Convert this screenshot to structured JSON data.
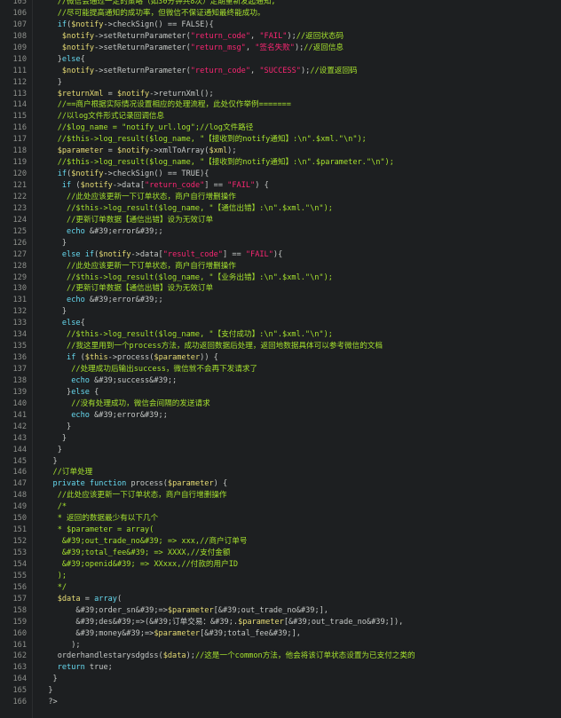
{
  "editor": {
    "lines": [
      {
        "n": "105",
        "segs": [
          {
            "t": "    "
          },
          {
            "c": "c",
            "t": "//微信会通过一定的策略（如30分钟共8次）定期重新发起通知,"
          }
        ]
      },
      {
        "n": "106",
        "segs": [
          {
            "t": "    "
          },
          {
            "c": "c",
            "t": "//尽可能提高通知的成功率，但微信不保证通知最终能成功。"
          }
        ]
      },
      {
        "n": "107",
        "segs": [
          {
            "t": "    "
          },
          {
            "c": "kw",
            "t": "if"
          },
          {
            "t": "("
          },
          {
            "c": "v",
            "t": "$notify"
          },
          {
            "t": "->checkSign() == FALSE){"
          }
        ]
      },
      {
        "n": "108",
        "segs": [
          {
            "t": "     "
          },
          {
            "c": "v",
            "t": "$notify"
          },
          {
            "t": "->setReturnParameter("
          },
          {
            "c": "s",
            "t": "\"return_code\""
          },
          {
            "t": ", "
          },
          {
            "c": "s",
            "t": "\"FAIL\""
          },
          {
            "t": ");"
          },
          {
            "c": "c",
            "t": "//返回状态码"
          }
        ]
      },
      {
        "n": "109",
        "segs": [
          {
            "t": "     "
          },
          {
            "c": "v",
            "t": "$notify"
          },
          {
            "t": "->setReturnParameter("
          },
          {
            "c": "s",
            "t": "\"return_msg\""
          },
          {
            "t": ", "
          },
          {
            "c": "s",
            "t": "\"签名失败\""
          },
          {
            "t": ");"
          },
          {
            "c": "c",
            "t": "//返回信息"
          }
        ]
      },
      {
        "n": "110",
        "segs": [
          {
            "t": "    }"
          },
          {
            "c": "kw",
            "t": "else"
          },
          {
            "t": "{"
          }
        ]
      },
      {
        "n": "111",
        "segs": [
          {
            "t": "     "
          },
          {
            "c": "v",
            "t": "$notify"
          },
          {
            "t": "->setReturnParameter("
          },
          {
            "c": "s",
            "t": "\"return_code\""
          },
          {
            "t": ", "
          },
          {
            "c": "s",
            "t": "\"SUCCESS\""
          },
          {
            "t": ");"
          },
          {
            "c": "c",
            "t": "//设置返回码"
          }
        ]
      },
      {
        "n": "112",
        "segs": [
          {
            "t": "    }"
          }
        ]
      },
      {
        "n": "113",
        "segs": [
          {
            "t": "    "
          },
          {
            "c": "v",
            "t": "$returnXml"
          },
          {
            "t": " = "
          },
          {
            "c": "v",
            "t": "$notify"
          },
          {
            "t": "->returnXml();"
          }
        ]
      },
      {
        "n": "114",
        "segs": [
          {
            "t": "    "
          },
          {
            "c": "c",
            "t": "//==商户根据实际情况设置相应的处理流程，此处仅作举例======="
          }
        ]
      },
      {
        "n": "115",
        "segs": [
          {
            "t": "    "
          },
          {
            "c": "c",
            "t": "//以log文件形式记录回调信息"
          }
        ]
      },
      {
        "n": "116",
        "segs": [
          {
            "t": "    "
          },
          {
            "c": "c",
            "t": "//$log_name = \"notify_url.log\";//log文件路径"
          }
        ]
      },
      {
        "n": "117",
        "segs": [
          {
            "t": "    "
          },
          {
            "c": "c",
            "t": "//$this->log_result($log_name, \"【接收到的notify通知】:\\n\".$xml.\"\\n\");"
          }
        ]
      },
      {
        "n": "118",
        "segs": [
          {
            "t": "    "
          },
          {
            "c": "v",
            "t": "$parameter"
          },
          {
            "t": " = "
          },
          {
            "c": "v",
            "t": "$notify"
          },
          {
            "t": "->xmlToArray("
          },
          {
            "c": "v",
            "t": "$xml"
          },
          {
            "t": ");"
          }
        ]
      },
      {
        "n": "119",
        "segs": [
          {
            "t": "    "
          },
          {
            "c": "c",
            "t": "//$this->log_result($log_name, \"【接收到的notify通知】:\\n\".$parameter.\"\\n\");"
          }
        ]
      },
      {
        "n": "120",
        "segs": [
          {
            "t": "    "
          },
          {
            "c": "kw",
            "t": "if"
          },
          {
            "t": "("
          },
          {
            "c": "v",
            "t": "$notify"
          },
          {
            "t": "->checkSign() == TRUE){"
          }
        ]
      },
      {
        "n": "121",
        "segs": [
          {
            "t": "     "
          },
          {
            "c": "kw",
            "t": "if"
          },
          {
            "t": " ("
          },
          {
            "c": "v",
            "t": "$notify"
          },
          {
            "t": "->data["
          },
          {
            "c": "s",
            "t": "\"return_code\""
          },
          {
            "t": "] == "
          },
          {
            "c": "s",
            "t": "\"FAIL\""
          },
          {
            "t": ") {"
          }
        ]
      },
      {
        "n": "122",
        "segs": [
          {
            "t": "      "
          },
          {
            "c": "c",
            "t": "//此处应该更新一下订单状态，商户自行增删操作"
          }
        ]
      },
      {
        "n": "123",
        "segs": [
          {
            "t": "      "
          },
          {
            "c": "c",
            "t": "//$this->log_result($log_name, \"【通信出错】:\\n\".$xml.\"\\n\");"
          }
        ]
      },
      {
        "n": "124",
        "segs": [
          {
            "t": "      "
          },
          {
            "c": "c",
            "t": "//更新订单数据【通信出错】设为无效订单"
          }
        ]
      },
      {
        "n": "125",
        "segs": [
          {
            "t": "      "
          },
          {
            "c": "kw",
            "t": "echo"
          },
          {
            "t": " &#39;error&#39;;"
          }
        ]
      },
      {
        "n": "126",
        "segs": [
          {
            "t": "     }"
          }
        ]
      },
      {
        "n": "127",
        "segs": [
          {
            "t": "     "
          },
          {
            "c": "kw",
            "t": "else if"
          },
          {
            "t": "("
          },
          {
            "c": "v",
            "t": "$notify"
          },
          {
            "t": "->data["
          },
          {
            "c": "s",
            "t": "\"result_code\""
          },
          {
            "t": "] == "
          },
          {
            "c": "s",
            "t": "\"FAIL\""
          },
          {
            "t": "){"
          }
        ]
      },
      {
        "n": "128",
        "segs": [
          {
            "t": "      "
          },
          {
            "c": "c",
            "t": "//此处应该更新一下订单状态，商户自行增删操作"
          }
        ]
      },
      {
        "n": "129",
        "segs": [
          {
            "t": "      "
          },
          {
            "c": "c",
            "t": "//$this->log_result($log_name, \"【业务出错】:\\n\".$xml.\"\\n\");"
          }
        ]
      },
      {
        "n": "130",
        "segs": [
          {
            "t": "      "
          },
          {
            "c": "c",
            "t": "//更新订单数据【通信出错】设为无效订单"
          }
        ]
      },
      {
        "n": "131",
        "segs": [
          {
            "t": "      "
          },
          {
            "c": "kw",
            "t": "echo"
          },
          {
            "t": " &#39;error&#39;;"
          }
        ]
      },
      {
        "n": "132",
        "segs": [
          {
            "t": "     }"
          }
        ]
      },
      {
        "n": "133",
        "segs": [
          {
            "t": "     "
          },
          {
            "c": "kw",
            "t": "else"
          },
          {
            "t": "{"
          }
        ]
      },
      {
        "n": "134",
        "segs": [
          {
            "t": "      "
          },
          {
            "c": "c",
            "t": "//$this->log_result($log_name, \"【支付成功】:\\n\".$xml.\"\\n\");"
          }
        ]
      },
      {
        "n": "135",
        "segs": [
          {
            "t": "      "
          },
          {
            "c": "c",
            "t": "//我这里用到一个process方法，成功返回数据后处理，返回地数据具体可以参考微信的文档"
          }
        ]
      },
      {
        "n": "136",
        "segs": [
          {
            "t": "      "
          },
          {
            "c": "kw",
            "t": "if"
          },
          {
            "t": " ("
          },
          {
            "c": "v",
            "t": "$this"
          },
          {
            "t": "->process("
          },
          {
            "c": "v",
            "t": "$parameter"
          },
          {
            "t": ")) {"
          }
        ]
      },
      {
        "n": "137",
        "segs": [
          {
            "t": "       "
          },
          {
            "c": "c",
            "t": "//处理成功后输出success，微信就不会再下发请求了"
          }
        ]
      },
      {
        "n": "138",
        "segs": [
          {
            "t": "       "
          },
          {
            "c": "kw",
            "t": "echo"
          },
          {
            "t": " &#39;success&#39;;"
          }
        ]
      },
      {
        "n": "139",
        "segs": [
          {
            "t": "      }"
          },
          {
            "c": "kw",
            "t": "else"
          },
          {
            "t": " {"
          }
        ]
      },
      {
        "n": "140",
        "segs": [
          {
            "t": "       "
          },
          {
            "c": "c",
            "t": "//没有处理成功，微信会间隔的发送请求"
          }
        ]
      },
      {
        "n": "141",
        "segs": [
          {
            "t": "       "
          },
          {
            "c": "kw",
            "t": "echo"
          },
          {
            "t": " &#39;error&#39;;"
          }
        ]
      },
      {
        "n": "142",
        "segs": [
          {
            "t": "      }"
          }
        ]
      },
      {
        "n": "143",
        "segs": [
          {
            "t": "     }"
          }
        ]
      },
      {
        "n": "144",
        "segs": [
          {
            "t": "    }"
          }
        ]
      },
      {
        "n": "145",
        "segs": [
          {
            "t": "   }"
          }
        ]
      },
      {
        "n": "146",
        "segs": [
          {
            "t": "   "
          },
          {
            "c": "c",
            "t": "//订单处理"
          }
        ]
      },
      {
        "n": "147",
        "segs": [
          {
            "t": "   "
          },
          {
            "c": "kw",
            "t": "private function"
          },
          {
            "t": " process("
          },
          {
            "c": "v",
            "t": "$parameter"
          },
          {
            "t": ") {"
          }
        ]
      },
      {
        "n": "148",
        "segs": [
          {
            "t": "    "
          },
          {
            "c": "c",
            "t": "//此处应该更新一下订单状态，商户自行增删操作"
          }
        ]
      },
      {
        "n": "149",
        "segs": [
          {
            "t": "    "
          },
          {
            "c": "c",
            "t": "/*"
          }
        ]
      },
      {
        "n": "150",
        "segs": [
          {
            "t": "    "
          },
          {
            "c": "c",
            "t": "* 返回的数据最少有以下几个"
          }
        ]
      },
      {
        "n": "151",
        "segs": [
          {
            "t": "    "
          },
          {
            "c": "c",
            "t": "* $parameter = array("
          }
        ]
      },
      {
        "n": "152",
        "segs": [
          {
            "t": "     "
          },
          {
            "c": "c",
            "t": "&#39;out_trade_no&#39; => xxx,//商户订单号"
          }
        ]
      },
      {
        "n": "153",
        "segs": [
          {
            "t": "     "
          },
          {
            "c": "c",
            "t": "&#39;total_fee&#39; => XXXX,//支付金额"
          }
        ]
      },
      {
        "n": "154",
        "segs": [
          {
            "t": "     "
          },
          {
            "c": "c",
            "t": "&#39;openid&#39; => XXxxx,//付款的用户ID"
          }
        ]
      },
      {
        "n": "155",
        "segs": [
          {
            "t": "    "
          },
          {
            "c": "c",
            "t": ");"
          }
        ]
      },
      {
        "n": "156",
        "segs": [
          {
            "t": "    "
          },
          {
            "c": "c",
            "t": "*/"
          }
        ]
      },
      {
        "n": "157",
        "segs": [
          {
            "t": "    "
          },
          {
            "c": "v",
            "t": "$data"
          },
          {
            "t": " = "
          },
          {
            "c": "kw",
            "t": "array"
          },
          {
            "t": "("
          }
        ]
      },
      {
        "n": "158",
        "segs": [
          {
            "t": "        &#39;order_sn&#39;=>"
          },
          {
            "c": "v",
            "t": "$parameter"
          },
          {
            "t": "[&#39;out_trade_no&#39;],"
          }
        ]
      },
      {
        "n": "159",
        "segs": [
          {
            "t": "        &#39;des&#39;=>(&#39;订单交易：&#39;."
          },
          {
            "c": "v",
            "t": "$parameter"
          },
          {
            "t": "[&#39;out_trade_no&#39;]),"
          }
        ]
      },
      {
        "n": "160",
        "segs": [
          {
            "t": "        &#39;money&#39;=>"
          },
          {
            "c": "v",
            "t": "$parameter"
          },
          {
            "t": "[&#39;total_fee&#39;],"
          }
        ]
      },
      {
        "n": "161",
        "segs": [
          {
            "t": "       );"
          }
        ]
      },
      {
        "n": "162",
        "segs": [
          {
            "t": "    orderhandlestarysdgdss("
          },
          {
            "c": "v",
            "t": "$data"
          },
          {
            "t": ");"
          },
          {
            "c": "c",
            "t": "//这是一个common方法，他会将该订单状态设置为已支付之类的"
          }
        ]
      },
      {
        "n": "163",
        "segs": [
          {
            "t": "    "
          },
          {
            "c": "kw",
            "t": "return"
          },
          {
            "t": " true;"
          }
        ]
      },
      {
        "n": "164",
        "segs": [
          {
            "t": "   }"
          }
        ]
      },
      {
        "n": "165",
        "segs": [
          {
            "t": "  }"
          }
        ]
      },
      {
        "n": "166",
        "segs": [
          {
            "t": "  ?>"
          }
        ]
      }
    ]
  },
  "colors": {
    "background": "#1d1f21",
    "comment": "#a6e22e",
    "variable": "#e6db74",
    "keyword": "#66d9ef",
    "string": "#f92672",
    "plain": "#c5c8c6",
    "line_number": "#8e908c"
  }
}
